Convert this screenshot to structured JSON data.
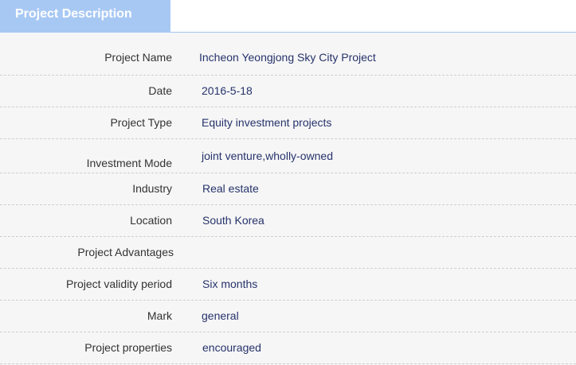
{
  "tab": {
    "title": "Project Description"
  },
  "fields": [
    {
      "label": "Project Name",
      "value": "Incheon Yeongjong Sky City Project"
    },
    {
      "label": "Date",
      "value": "2016-5-18"
    },
    {
      "label": "Project Type",
      "value": "Equity investment projects"
    },
    {
      "label": "Investment Mode",
      "value": "joint venture,wholly-owned"
    },
    {
      "label": "Industry",
      "value": "Real estate"
    },
    {
      "label": "Location",
      "value": "South Korea"
    },
    {
      "label": "Project Advantages",
      "value": ""
    },
    {
      "label": "Project validity period",
      "value": "Six months"
    },
    {
      "label": "Mark",
      "value": "general"
    },
    {
      "label": "Project properties",
      "value": "encouraged"
    }
  ]
}
